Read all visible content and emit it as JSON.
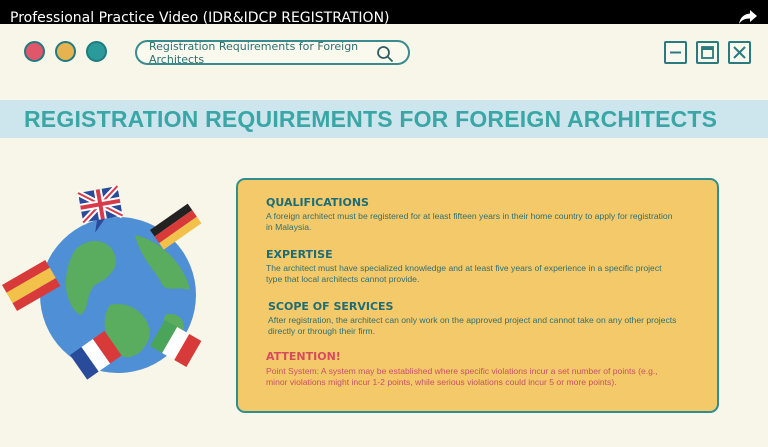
{
  "video_title": "Professional Practice Video (IDR&IDCP REGISTRATION)",
  "search": {
    "text": "Registration Requirements for Foreign Architects"
  },
  "banner_title": "REGISTRATION REQUIREMENTS FOR FOREIGN ARCHITECTS",
  "sections": [
    {
      "title": "QUALIFICATIONS",
      "body": "A foreign architect must be registered for at least fifteen years in their home country to apply for registration in Malaysia."
    },
    {
      "title": "EXPERTISE",
      "body": "The architect must have specialized knowledge and at least five years of experience in a specific project type that local architects cannot provide."
    },
    {
      "title": "SCOPE OF SERVICES",
      "body": "After registration, the architect can only work on the approved project and cannot take on any other projects directly or through their firm."
    },
    {
      "title": "ATTENTION!",
      "body": "Point System: A system may be established where specific violations incur a set number of points (e.g., minor violations might incur 1-2 points, while serious violations could incur 5 or more points)."
    }
  ],
  "colors": {
    "accent": "#3aa6a6",
    "card": "#f4c96a",
    "attention": "#d64b5d"
  },
  "icons": [
    "share-icon",
    "search-icon",
    "minimize-icon",
    "maximize-icon",
    "close-icon",
    "globe-icon"
  ]
}
